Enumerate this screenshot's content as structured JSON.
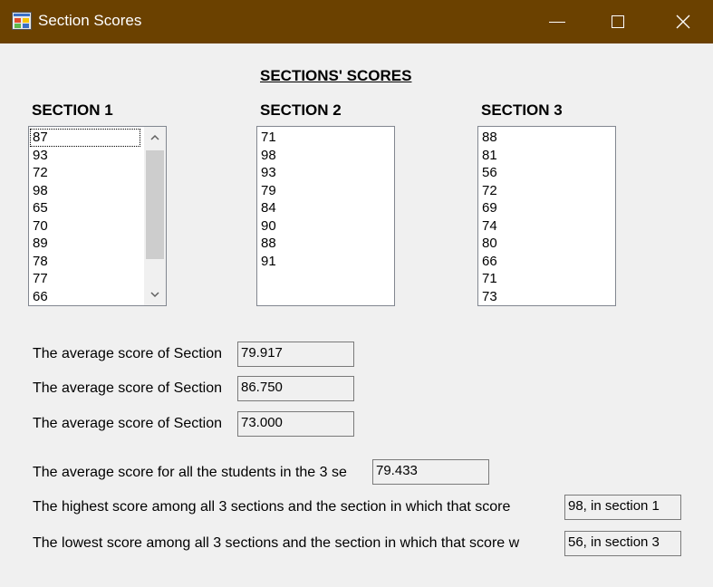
{
  "window": {
    "title": "Section Scores"
  },
  "heading": "SECTIONS' SCORES",
  "sections": [
    {
      "label": "SECTION 1",
      "scores": [
        "87",
        "93",
        "72",
        "98",
        "65",
        "70",
        "89",
        "78",
        "77",
        "66"
      ]
    },
    {
      "label": "SECTION 2",
      "scores": [
        "71",
        "98",
        "93",
        "79",
        "84",
        "90",
        "88",
        "91"
      ]
    },
    {
      "label": "SECTION 3",
      "scores": [
        "88",
        "81",
        "56",
        "72",
        "69",
        "74",
        "80",
        "66",
        "71",
        "73"
      ]
    }
  ],
  "results": {
    "avg_label_1": "The average score of Section",
    "avg_value_1": "79.917",
    "avg_label_2": "The average score of Section",
    "avg_value_2": "86.750",
    "avg_label_3": "The average score of Section",
    "avg_value_3": "73.000",
    "overall_label": "The average score for all the students in the 3 se",
    "overall_value": "79.433",
    "highest_label": "The highest score among all 3 sections and the section in which that score",
    "highest_value": "98, in section 1",
    "lowest_label": "The lowest score among all 3 sections and the section in which that score w",
    "lowest_value": "56, in section 3"
  },
  "colors": {
    "titlebar": "#6b4100",
    "background": "#f0f0f0"
  },
  "icons": [
    "app-icon",
    "minimize-icon",
    "maximize-icon",
    "close-icon",
    "scroll-up-icon",
    "scroll-down-icon"
  ]
}
